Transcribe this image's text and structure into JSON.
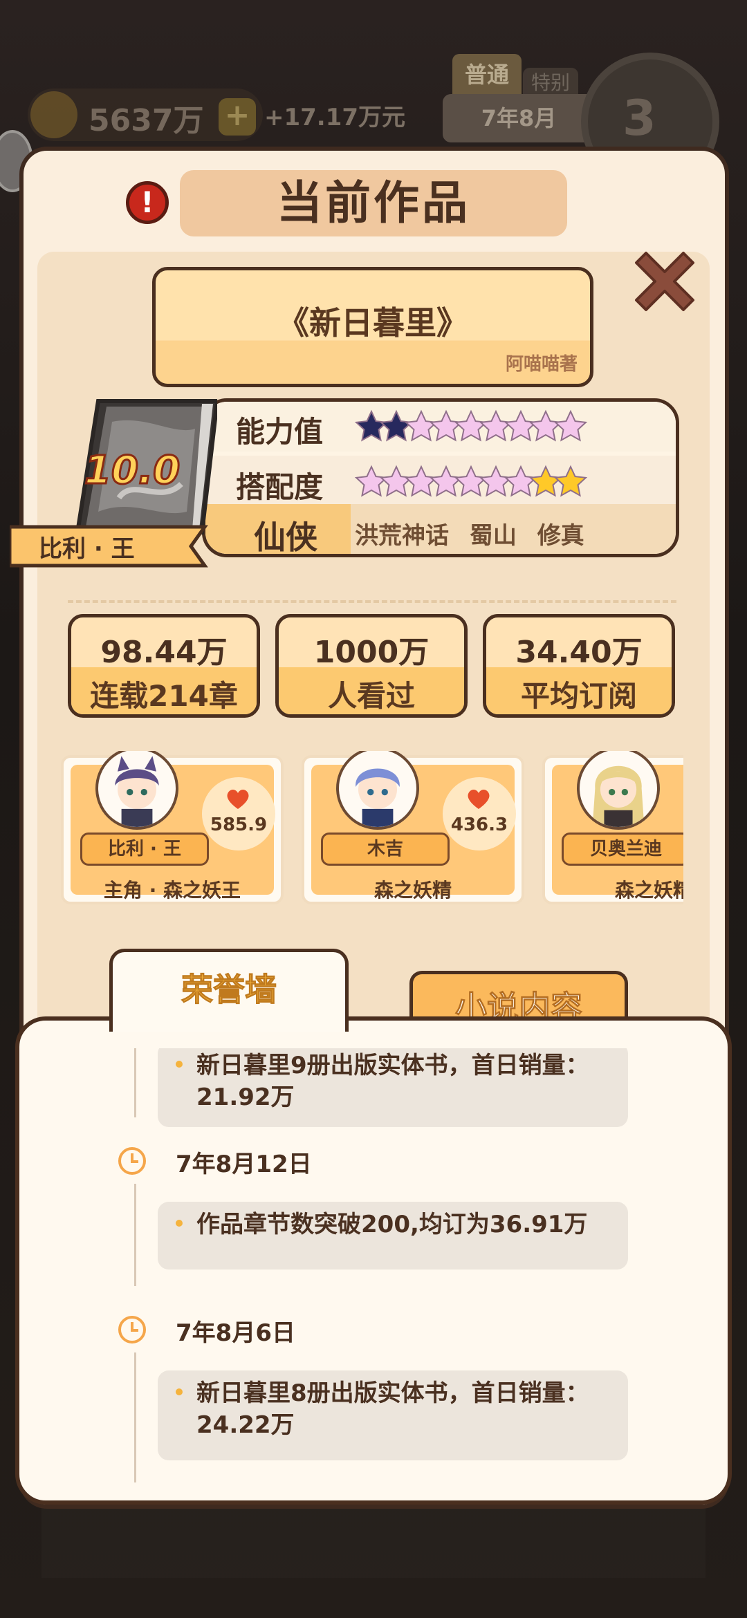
{
  "hud": {
    "coins": "5637万",
    "plus": "+",
    "income": "+17.17万元",
    "mode_tab": "普通",
    "mode_tab_2": "特别",
    "date": "7年8月",
    "clock_number": "3"
  },
  "panel": {
    "title": "当前作品",
    "alert": "!"
  },
  "book": {
    "title": "《新日暮里》",
    "author": "阿喵喵著",
    "score": "10.0",
    "owner": "比利 · 王",
    "ability_label": "能力值",
    "match_label": "搭配度",
    "ability_stars": 2,
    "match_stars": 2,
    "stars_total": 9,
    "genre": "仙侠",
    "tags": [
      "洪荒神话",
      "蜀山",
      "修真"
    ]
  },
  "metrics": [
    {
      "value": "98.44万",
      "label": "连载214章"
    },
    {
      "value": "1000万",
      "label": "人看过"
    },
    {
      "value": "34.40万",
      "label": "平均订阅"
    }
  ],
  "characters": [
    {
      "name": "比利 · 王",
      "role": "主角 · 森之妖王",
      "love": "585.9",
      "hair": "#5b4d86"
    },
    {
      "name": "木吉",
      "role": "森之妖精",
      "love": "436.3",
      "hair": "#7d8fd6"
    },
    {
      "name": "贝奥兰迪",
      "role": "森之妖精",
      "love": "",
      "hair": "#e9d28a"
    }
  ],
  "tabs": {
    "honor": "荣誉墙",
    "content": "小说内容"
  },
  "honor_events": [
    {
      "date": "",
      "text": "新日暮里9册出版实体书，首日销量：21.92万"
    },
    {
      "date": "7年8月12日",
      "text": "作品章节数突破200,均订为36.91万"
    },
    {
      "date": "7年8月6日",
      "text": "新日暮里8册出版实体书，首日销量：24.22万"
    }
  ],
  "colors": {
    "panel_bg": "#fbeedd",
    "border": "#4a2f1f",
    "accent_orange": "#fcc970",
    "star_filled": "#27295e",
    "star_gold": "#ffc928",
    "heart": "#e8502a"
  }
}
